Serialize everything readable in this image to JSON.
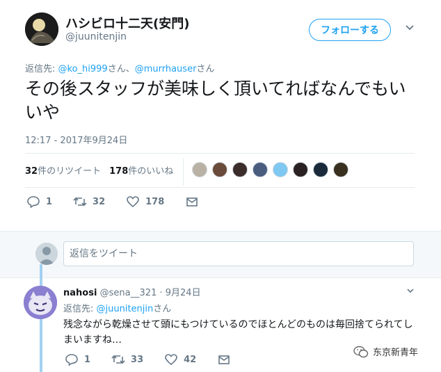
{
  "tweet": {
    "author_name": "ハシビロ十二天(安門)",
    "author_handle": "@juunitenjin",
    "follow_label": "フォローする",
    "reply_to_prefix": "返信先: ",
    "reply_to_user1": "@ko_hi999",
    "reply_to_san1": "さん、",
    "reply_to_user2": "@murrhauser",
    "reply_to_san2": "さん",
    "text": "その後スタッフが美味しく頂いてればなんでもいいや",
    "timestamp": "12:17 - 2017年9月24日",
    "retweets_count": "32",
    "retweets_label": "件のリツイート",
    "likes_count": "178",
    "likes_label": "件のいいね",
    "action_reply_count": "1",
    "action_retweet_count": "32",
    "action_like_count": "178"
  },
  "likers": [
    {
      "color": "#b9b2a4"
    },
    {
      "color": "#6b4b3a"
    },
    {
      "color": "#3b2d2a"
    },
    {
      "color": "#4a5d7e"
    },
    {
      "color": "#7ec8f2"
    },
    {
      "color": "#2a2222"
    },
    {
      "color": "#1a2a3a"
    },
    {
      "color": "#3a3020"
    }
  ],
  "reply_composer": {
    "placeholder": "返信をツイート"
  },
  "reply": {
    "author_name": "nahosi",
    "author_handle": "@sena__321",
    "separator": " · ",
    "date": "9月24日",
    "reply_to_prefix": "返信先: ",
    "reply_to_user": "@juunitenjin",
    "reply_to_san": "さん",
    "text": "残念ながら乾燥させて頭にもつけているのでほとんどのものは毎回捨てられてしまいますね…",
    "reply_count": "1",
    "retweet_count": "33",
    "like_count": "42"
  },
  "watermark": {
    "text": "东京新青年"
  },
  "colors": {
    "accent": "#1da1f2",
    "muted": "#657786",
    "text": "#14171a"
  }
}
